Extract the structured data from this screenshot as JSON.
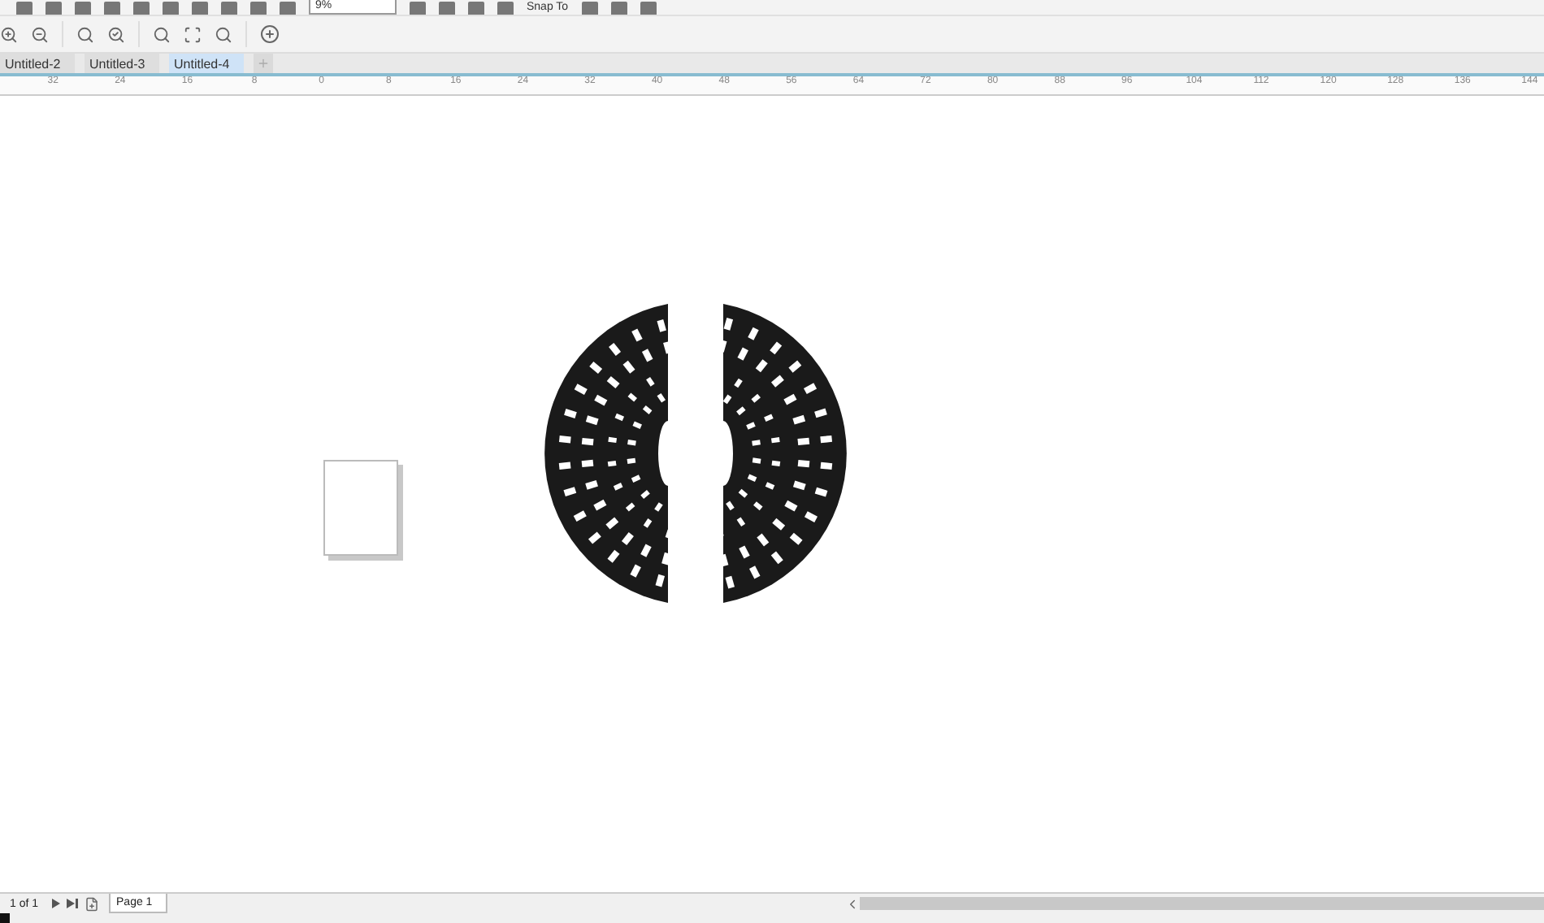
{
  "toolbar": {
    "zoom_value": "9%",
    "snap_label": "Snap To"
  },
  "tabs": [
    {
      "label": "Untitled-2",
      "selected": false
    },
    {
      "label": "Untitled-3",
      "selected": false
    },
    {
      "label": "Untitled-4",
      "selected": true
    }
  ],
  "ruler": {
    "labels": [
      "32",
      "24",
      "16",
      "8",
      "0",
      "8",
      "16",
      "24",
      "32",
      "40",
      "48",
      "56",
      "64",
      "72",
      "80",
      "88",
      "96",
      "104",
      "112",
      "120",
      "128",
      "136",
      "144"
    ]
  },
  "status_bar": {
    "page_count": "1 of 1",
    "page_tab": "Page 1"
  }
}
